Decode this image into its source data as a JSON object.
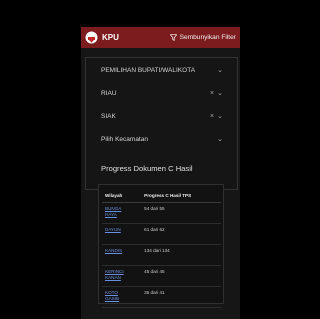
{
  "header": {
    "brand": "KPU",
    "filter_toggle_label": "Sembunyikan Filter"
  },
  "filters": [
    {
      "value": "PEMILIHAN BUPATI/WALIKOTA",
      "clearable": false
    },
    {
      "value": "RIAU",
      "clearable": true
    },
    {
      "value": "SIAK",
      "clearable": true
    },
    {
      "value": "Pilih Kecamatan",
      "clearable": false
    }
  ],
  "progress": {
    "title": "Progress Dokumen C Hasil",
    "columns": [
      "Wilayah",
      "Progress C Hasil TPS"
    ],
    "rows": [
      {
        "wilayah": "BUNGA RAYA",
        "progress": "54 dari 55"
      },
      {
        "wilayah": "DAYUN",
        "progress": "61 dari 62"
      },
      {
        "wilayah": "KANDIS",
        "progress": "134 dari 134"
      },
      {
        "wilayah": "KERINCI KANAN",
        "progress": "45 dari 45"
      },
      {
        "wilayah": "KOTO GASIB",
        "progress": "35 dari 41"
      }
    ]
  },
  "colors": {
    "header_bg": "#7d1c1e",
    "link": "#6a8ee0"
  }
}
